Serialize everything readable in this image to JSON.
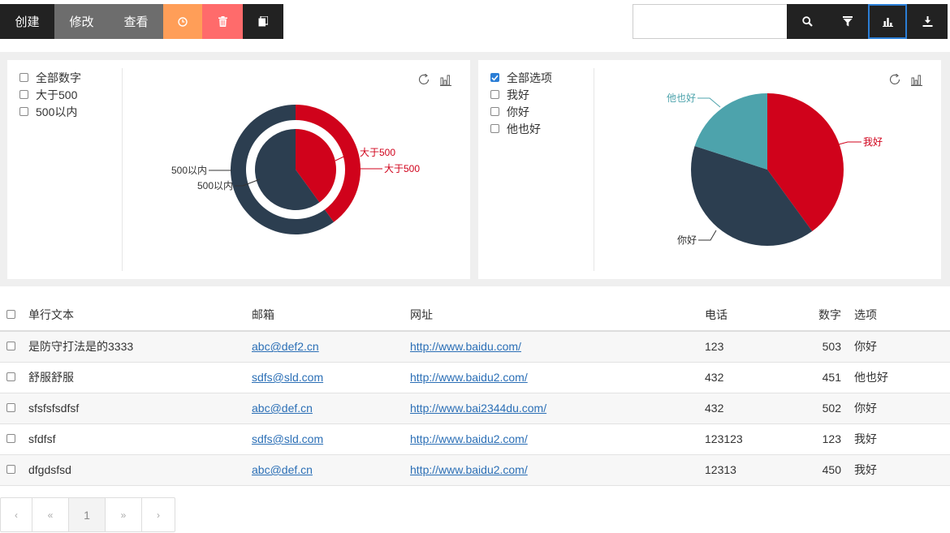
{
  "toolbar": {
    "create": "创建",
    "edit": "修改",
    "view": "查看",
    "icons": [
      "clock-icon",
      "trash-icon",
      "copy-icon"
    ]
  },
  "search": {
    "value": "",
    "placeholder": ""
  },
  "right_tools": [
    "search-icon",
    "filter-icon",
    "bar-chart-icon",
    "download-icon"
  ],
  "colors": {
    "red": "#d0021b",
    "navy": "#2c3e50",
    "teal": "#4da3ac",
    "link": "#2b6fb6"
  },
  "left_panel": {
    "filters": [
      {
        "label": "全部数字",
        "checked": false
      },
      {
        "label": "大于500",
        "checked": false
      },
      {
        "label": "500以内",
        "checked": false
      }
    ]
  },
  "right_panel": {
    "filters": [
      {
        "label": "全部选项",
        "checked": true
      },
      {
        "label": "我好",
        "checked": false
      },
      {
        "label": "你好",
        "checked": false
      },
      {
        "label": "他也好",
        "checked": false
      }
    ]
  },
  "chart_data": [
    {
      "type": "pie",
      "variant": "nested-donut",
      "inner": {
        "categories": [
          "大于500",
          "500以内"
        ],
        "values": [
          2,
          3
        ]
      },
      "outer": {
        "categories": [
          "大于500",
          "500以内"
        ],
        "values": [
          2,
          3
        ]
      },
      "colors": [
        "#d0021b",
        "#2c3e50"
      ],
      "labels": [
        "大于500",
        "大于500",
        "500以内",
        "500以内"
      ]
    },
    {
      "type": "pie",
      "categories": [
        "我好",
        "你好",
        "他也好"
      ],
      "values": [
        2,
        2,
        1
      ],
      "colors": [
        "#d0021b",
        "#2c3e50",
        "#4da3ac"
      ]
    }
  ],
  "table": {
    "headers": [
      "单行文本",
      "邮箱",
      "网址",
      "电话",
      "数字",
      "选项"
    ],
    "rows": [
      [
        "是防守打法是的3333",
        "abc@def2.cn",
        "http://www.baidu.com/",
        "123",
        "503",
        "你好"
      ],
      [
        "舒服舒服",
        "sdfs@sld.com",
        "http://www.baidu2.com/",
        "432",
        "451",
        "他也好"
      ],
      [
        "sfsfsfsdfsf",
        "abc@def.cn",
        "http://www.bai2344du.com/",
        "432",
        "502",
        "你好"
      ],
      [
        "sfdfsf",
        "sdfs@sld.com",
        "http://www.baidu2.com/",
        "123123",
        "123",
        "我好"
      ],
      [
        "dfgdsfsd",
        "abc@def.cn",
        "http://www.baidu2.com/",
        "12313",
        "450",
        "我好"
      ]
    ]
  },
  "pagination": {
    "prev": "‹",
    "first": "«",
    "current": "1",
    "last": "»",
    "next": "›"
  }
}
